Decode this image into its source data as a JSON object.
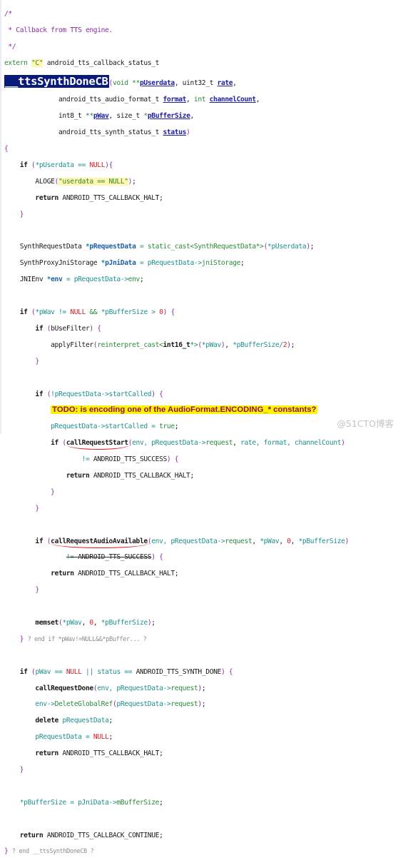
{
  "editor": {
    "comment_open": "/*",
    "comment_body": " * Callback from TTS engine.",
    "comment_close": " */",
    "extern_kw": "extern",
    "extern_str": "\"C\"",
    "return_type": "android_tts_callback_status_t",
    "function_name": "__ttsSynthDoneCB",
    "params": {
      "void": "void",
      "pUserdata": "pUserdata",
      "uint32_t": "uint32_t",
      "rate": "rate",
      "fmt_type": "android_tts_audio_format_t",
      "format": "format",
      "int": "int",
      "channelCount": "channelCount",
      "int8_t": "int8_t",
      "pWav": "pWav",
      "size_t": "size_t",
      "pBufferSize": "pBufferSize",
      "status_type": "android_tts_synth_status_t",
      "status": "status"
    },
    "todo_annotation": "TODO: is encoding one of the AudioFormat.ENCODING_* constants?",
    "end_if_comment": "? end if *pWav!=NULL&&*pBuffer... ?",
    "end_fn_comment": "? end __ttsSynthDoneCB ?",
    "underlined_calls": [
      "callRequestStart",
      "callRequestAudioAvailable"
    ]
  },
  "code": {
    "aloge_str": "\"userdata == NULL\"",
    "halt": "ANDROID_TTS_CALLBACK_HALT",
    "cont": "ANDROID_TTS_CALLBACK_CONTINUE",
    "success": "ANDROID_TTS_SUCCESS",
    "synth_done": "ANDROID_TTS_SYNTH_DONE",
    "null": "NULL"
  },
  "watermark": "@51CTO博客"
}
